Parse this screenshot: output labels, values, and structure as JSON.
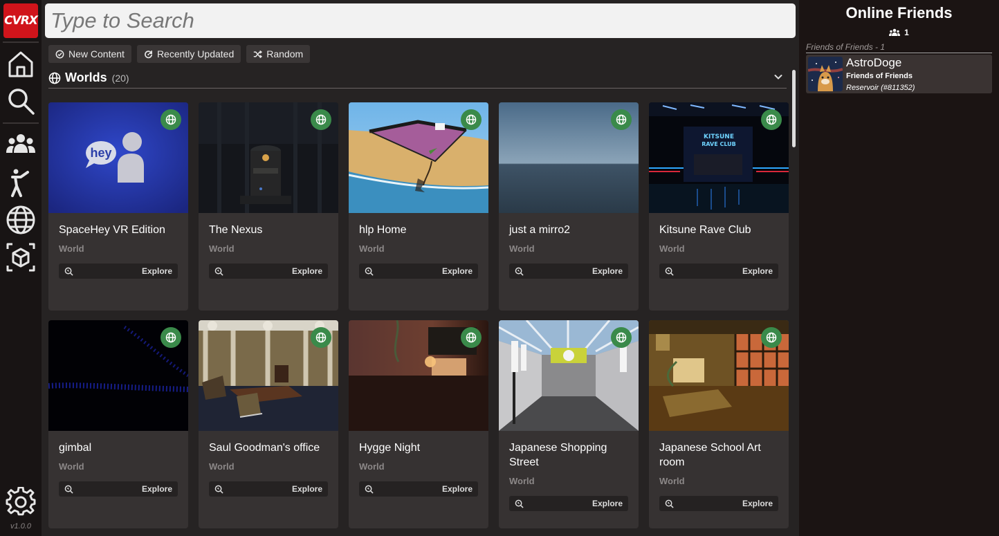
{
  "app": {
    "logo_text": "CVRX",
    "version": "v1.0.0",
    "brand_color": "#d0141b"
  },
  "nav": [
    {
      "icon": "home-icon"
    },
    {
      "icon": "search-icon"
    },
    {
      "icon": "friends-icon"
    },
    {
      "icon": "avatar-icon"
    },
    {
      "icon": "worlds-globe-icon"
    },
    {
      "icon": "props-cube-icon"
    },
    {
      "icon": "settings-gear-icon"
    }
  ],
  "search": {
    "placeholder": "Type to Search",
    "value": ""
  },
  "filters": [
    {
      "label": "New Content",
      "icon": "check-badge-icon"
    },
    {
      "label": "Recently Updated",
      "icon": "refresh-icon"
    },
    {
      "label": "Random",
      "icon": "shuffle-icon"
    }
  ],
  "section": {
    "title": "Worlds",
    "count": "(20)",
    "icon": "globe-icon"
  },
  "worlds": [
    {
      "title": "SpaceHey VR Edition",
      "type": "World",
      "action": "Explore"
    },
    {
      "title": "The Nexus",
      "type": "World",
      "action": "Explore"
    },
    {
      "title": "hlp Home",
      "type": "World",
      "action": "Explore"
    },
    {
      "title": "just a mirro2",
      "type": "World",
      "action": "Explore"
    },
    {
      "title": "Kitsune Rave Club",
      "type": "World",
      "action": "Explore"
    },
    {
      "title": "gimbal",
      "type": "World",
      "action": "Explore"
    },
    {
      "title": "Saul Goodman's office",
      "type": "World",
      "action": "Explore"
    },
    {
      "title": "Hygge Night",
      "type": "World",
      "action": "Explore"
    },
    {
      "title": "Japanese Shopping Street",
      "type": "World",
      "action": "Explore"
    },
    {
      "title": "Japanese School Art room",
      "type": "World",
      "action": "Explore"
    }
  ],
  "thumb_text": {
    "spacehey": "hey",
    "kitsune_line1": "KITSUNE",
    "kitsune_line2": "RAVE CLUB"
  },
  "friends": {
    "title": "Online Friends",
    "count": "1",
    "group_label": "Friends of Friends - 1",
    "list": [
      {
        "name": "AstroDoge",
        "status": "Friends of Friends",
        "location": "Reservoir (#811352)"
      }
    ]
  },
  "colors": {
    "badge_green": "#3a8a4a",
    "card_bg": "#363232",
    "main_bg": "#262323"
  }
}
